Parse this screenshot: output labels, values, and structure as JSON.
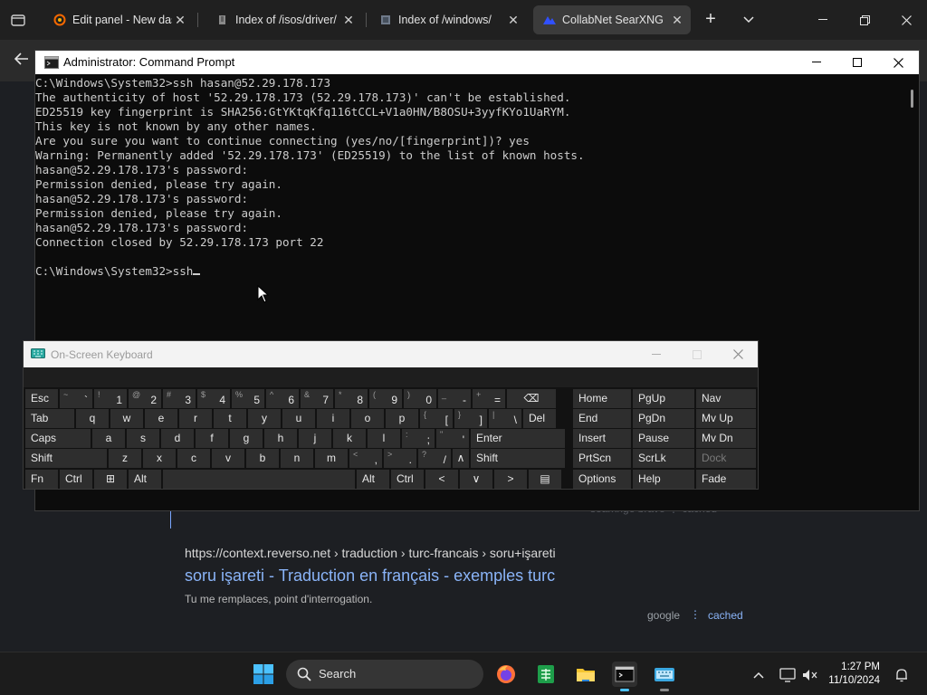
{
  "browser": {
    "tabs": [
      {
        "label": "Edit panel - New dashb",
        "icon": "grafana-icon"
      },
      {
        "label": "Index of /isos/driver/",
        "icon": "index-icon"
      },
      {
        "label": "Index of /windows/",
        "icon": "index-icon"
      },
      {
        "label": "CollabNet SearXNG",
        "icon": "searxng-icon",
        "active": true
      }
    ],
    "close_glyph": "✕",
    "newtab_glyph": "+"
  },
  "page": {
    "faded_meta": "searxnge  brave  ⋮  cached",
    "result": {
      "url": "https://context.reverso.net  › traduction › turc-francais › soru+işareti",
      "title": "soru işareti - Traduction en français - exemples turc",
      "snippet": "Tu me remplaces, point d'interrogation.",
      "engine": "google",
      "dots": "⋮",
      "cached": "cached"
    }
  },
  "cmd": {
    "title": "Administrator: Command Prompt",
    "lines": [
      "C:\\Windows\\System32>ssh hasan@52.29.178.173",
      "The authenticity of host '52.29.178.173 (52.29.178.173)' can't be established.",
      "ED25519 key fingerprint is SHA256:GtYKtqKfq116tCCL+V1a0HN/B8OSU+3yyfKYo1UaRYM.",
      "This key is not known by any other names.",
      "Are you sure you want to continue connecting (yes/no/[fingerprint])? yes",
      "Warning: Permanently added '52.29.178.173' (ED25519) to the list of known hosts.",
      "hasan@52.29.178.173's password:",
      "Permission denied, please try again.",
      "hasan@52.29.178.173's password:",
      "Permission denied, please try again.",
      "hasan@52.29.178.173's password:",
      "Connection closed by 52.29.178.173 port 22",
      ""
    ],
    "prompt": "C:\\Windows\\System32>ssh"
  },
  "osk": {
    "title": "On-Screen Keyboard",
    "row1": [
      {
        "main": "Esc"
      },
      {
        "shift": "~",
        "primary": "`"
      },
      {
        "shift": "!",
        "primary": "1"
      },
      {
        "shift": "@",
        "primary": "2"
      },
      {
        "shift": "#",
        "primary": "3"
      },
      {
        "shift": "$",
        "primary": "4"
      },
      {
        "shift": "%",
        "primary": "5"
      },
      {
        "shift": "^",
        "primary": "6"
      },
      {
        "shift": "&",
        "primary": "7"
      },
      {
        "shift": "*",
        "primary": "8"
      },
      {
        "shift": "(",
        "primary": "9"
      },
      {
        "shift": ")",
        "primary": "0"
      },
      {
        "shift": "_",
        "primary": "-"
      },
      {
        "shift": "+",
        "primary": "="
      },
      {
        "main": "⌫"
      }
    ],
    "row2": [
      {
        "main": "Tab"
      },
      {
        "main": "q"
      },
      {
        "main": "w"
      },
      {
        "main": "e"
      },
      {
        "main": "r"
      },
      {
        "main": "t"
      },
      {
        "main": "y"
      },
      {
        "main": "u"
      },
      {
        "main": "i"
      },
      {
        "main": "o"
      },
      {
        "main": "p"
      },
      {
        "shift": "{",
        "primary": "["
      },
      {
        "shift": "}",
        "primary": "]"
      },
      {
        "shift": "|",
        "primary": "\\"
      },
      {
        "main": "Del"
      }
    ],
    "row3": [
      {
        "main": "Caps"
      },
      {
        "main": "a"
      },
      {
        "main": "s"
      },
      {
        "main": "d"
      },
      {
        "main": "f"
      },
      {
        "main": "g"
      },
      {
        "main": "h"
      },
      {
        "main": "j"
      },
      {
        "main": "k"
      },
      {
        "main": "l"
      },
      {
        "shift": ":",
        "primary": ";"
      },
      {
        "shift": "\"",
        "primary": "'"
      },
      {
        "main": "Enter"
      }
    ],
    "row4": [
      {
        "main": "Shift"
      },
      {
        "main": "z"
      },
      {
        "main": "x"
      },
      {
        "main": "c"
      },
      {
        "main": "v"
      },
      {
        "main": "b"
      },
      {
        "main": "n"
      },
      {
        "main": "m"
      },
      {
        "shift": "<",
        "primary": ","
      },
      {
        "shift": ">",
        "primary": "."
      },
      {
        "shift": "?",
        "primary": "/"
      },
      {
        "main": "∧"
      },
      {
        "main": "Shift"
      }
    ],
    "row5": [
      {
        "main": "Fn"
      },
      {
        "main": "Ctrl"
      },
      {
        "main": "⊞"
      },
      {
        "main": "Alt"
      },
      {
        "main": ""
      },
      {
        "main": "Alt"
      },
      {
        "main": "Ctrl"
      },
      {
        "main": "<"
      },
      {
        "main": "∨"
      },
      {
        "main": ">"
      },
      {
        "main": "▤"
      }
    ],
    "nav": [
      [
        "Home",
        "PgUp",
        "Nav"
      ],
      [
        "End",
        "PgDn",
        "Mv Up"
      ],
      [
        "Insert",
        "Pause",
        "Mv Dn"
      ],
      [
        "PrtScn",
        "ScrLk",
        "Dock"
      ],
      [
        "Options",
        "Help",
        "Fade"
      ]
    ]
  },
  "taskbar": {
    "search_label": "Search",
    "time": "1:27 PM",
    "date": "11/10/2024"
  }
}
